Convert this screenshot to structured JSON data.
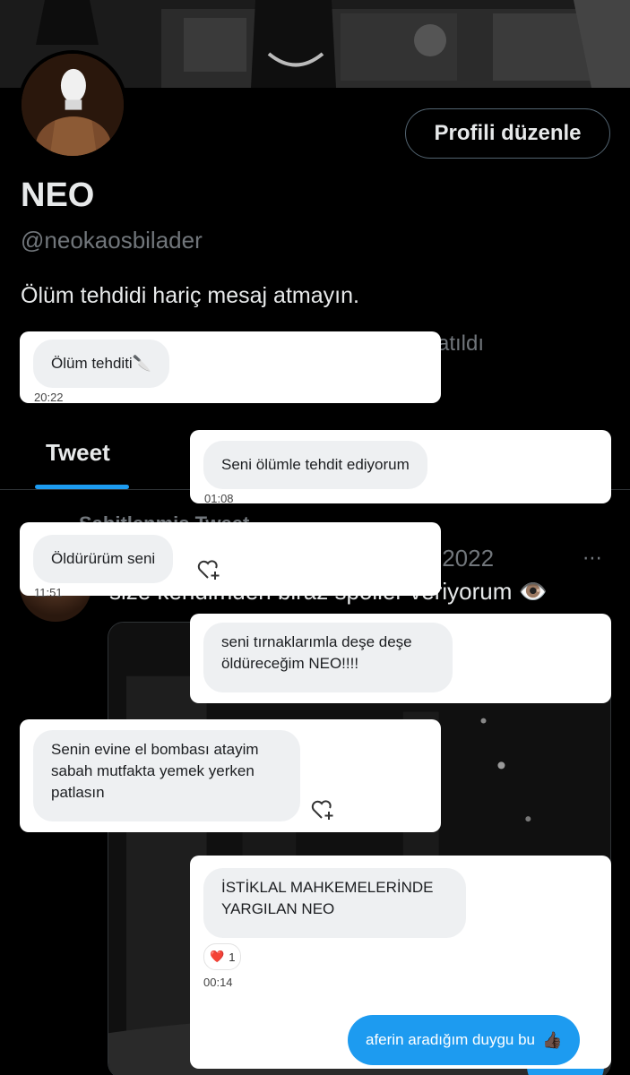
{
  "profile": {
    "edit_button_label": "Profili düzenle",
    "display_name": "NEO",
    "handle": "@neokaosbilader",
    "bio": "Ölüm tehdidi hariç mesaj atmayın.",
    "joined_fragment": "atıldı"
  },
  "tabs": {
    "active_label": "Tweet"
  },
  "pinned_tweet": {
    "pinned_label_fragment": "Sabitlenmiş Tweet",
    "date_fragment": ".2022",
    "text_fragment": "size kendimden biraz spoiler veriyorum 👁️",
    "more_icon": "⋯"
  },
  "messages": [
    {
      "text": "Ölüm tehditi🔪",
      "time": "20:22"
    },
    {
      "text": "Seni ölümle tehdit ediyorum",
      "time": "01:08"
    },
    {
      "text": "Öldürürüm seni",
      "time": "11:51"
    },
    {
      "text": "seni tırnaklarımla deşe deşe öldüreceğim NEO!!!!",
      "time": ""
    },
    {
      "text": "Senin evine el bombası atayim sabah mutfakta yemek yerken patlasın",
      "time": ""
    },
    {
      "text": "İSTİKLAL MAHKEMELERİNDE YARGILAN NEO",
      "time": "00:14",
      "reaction_emoji": "❤️",
      "reaction_count": "1"
    }
  ],
  "sent_message": {
    "text": "aferin aradığım duygu bu",
    "emoji": "👍🏿"
  },
  "colors": {
    "accent": "#1d9bf0",
    "background": "#000000",
    "muted_text": "#71767b",
    "bubble": "#eef0f2"
  },
  "icons": [
    "pin-icon",
    "more-icon",
    "heart-plus-icon"
  ]
}
